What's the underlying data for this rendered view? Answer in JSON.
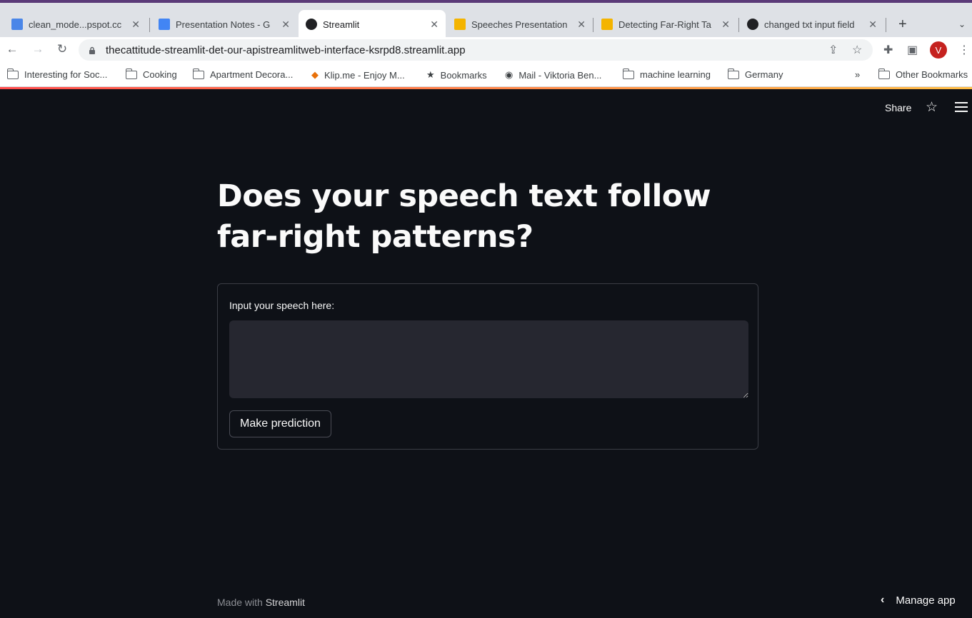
{
  "browser": {
    "tabs": [
      {
        "label": "clean_mode...pspot.cc",
        "icon": "sheets-icon",
        "color": "#4a86e8"
      },
      {
        "label": "Presentation Notes - G",
        "icon": "docs-icon",
        "color": "#4285f4"
      },
      {
        "label": "Streamlit",
        "icon": "streamlit-icon",
        "color": "#202124"
      },
      {
        "label": "Speeches Presentation",
        "icon": "slides-icon",
        "color": "#f4b400"
      },
      {
        "label": "Detecting Far-Right Ta",
        "icon": "slides-icon",
        "color": "#f4b400"
      },
      {
        "label": "changed txt input field",
        "icon": "github-icon",
        "color": "#202124"
      }
    ],
    "url": "thecattitude-streamlit-det-our-apistreamlitweb-interface-ksrpd8.streamlit.app",
    "profile_initial": "V",
    "bookmarks": [
      {
        "label": "Interesting for Soc...",
        "icon": "folder-icon"
      },
      {
        "label": "Cooking",
        "icon": "folder-icon"
      },
      {
        "label": "Apartment Decora...",
        "icon": "folder-icon"
      },
      {
        "label": "Klip.me - Enjoy M...",
        "icon": "klip-icon"
      },
      {
        "label": "Bookmarks",
        "icon": "star-icon"
      },
      {
        "label": "Mail - Viktoria Ben...",
        "icon": "globe-icon"
      },
      {
        "label": "machine learning",
        "icon": "folder-icon"
      },
      {
        "label": "Germany",
        "icon": "folder-icon"
      }
    ],
    "overflow_label": "»",
    "other_bookmarks": "Other Bookmarks"
  },
  "app": {
    "share_label": "Share",
    "title": "Does your speech text follow far-right patterns?",
    "form": {
      "input_label": "Input your speech here:",
      "input_value": "",
      "button_label": "Make prediction"
    },
    "footer_prefix": "Made with",
    "footer_brand": "Streamlit",
    "manage_label": "Manage app"
  },
  "colors": {
    "background": "#0e1117",
    "text": "#fafafa",
    "input_bg": "#262730",
    "accent_gradient_start": "#ff4b4b",
    "accent_gradient_end": "#ffbd45"
  }
}
